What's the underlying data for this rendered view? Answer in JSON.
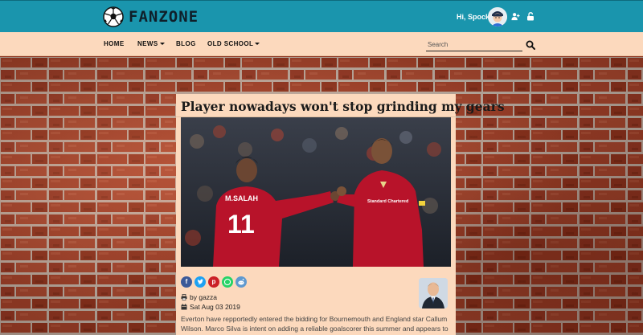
{
  "header": {
    "logo_text": "FANZONE",
    "greeting": "Hi, Spock!",
    "icons": [
      "soccer-ball-icon",
      "user-plus-icon",
      "unlock-icon"
    ],
    "bar_color": "#1a95ad"
  },
  "nav": {
    "items": [
      {
        "label": "HOME",
        "dropdown": false
      },
      {
        "label": "NEWS",
        "dropdown": true
      },
      {
        "label": "BLOG",
        "dropdown": false
      },
      {
        "label": "OLD SCHOOL",
        "dropdown": true
      }
    ],
    "search_placeholder": "Search",
    "bar_color": "#fcd9bd"
  },
  "article": {
    "title": "Player nowadays won't stop grinding my gears",
    "author": "by gazza",
    "date": "Sat Aug 03 2019",
    "body": "Everton have repportedly entered the bidding for Bournemouth and England star Callum Wilson. Marco Silva is intent on adding a reliable goalscorer this summer and appears to",
    "share_icons": [
      "facebook-icon",
      "twitter-icon",
      "pinterest-icon",
      "whatsapp-icon",
      "reddit-icon"
    ],
    "photo_jerseys": {
      "left_name": "M.SALAH",
      "left_number": "11",
      "right_sponsor": "Standard Chartered"
    }
  }
}
